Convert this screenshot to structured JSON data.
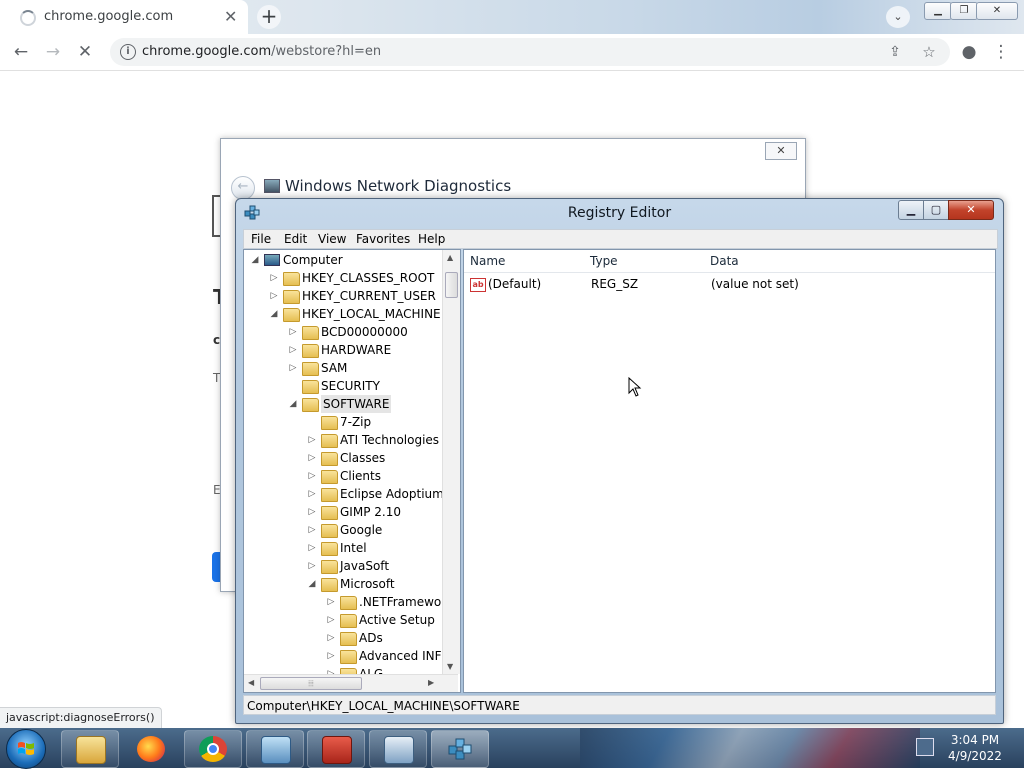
{
  "browser": {
    "tab_title": "chrome.google.com",
    "url_host": "chrome.google.com",
    "url_path": "/webstore?hl=en",
    "status_text": "javascript:diagnoseErrors()"
  },
  "net_diagnostics": {
    "title": "Windows Network Diagnostics"
  },
  "regedit": {
    "title": "Registry Editor",
    "menu": [
      "File",
      "Edit",
      "View",
      "Favorites",
      "Help"
    ],
    "tree": [
      {
        "label": "Computer",
        "level": 0,
        "arrow": "open"
      },
      {
        "label": "HKEY_CLASSES_ROOT",
        "level": 1,
        "arrow": "closed"
      },
      {
        "label": "HKEY_CURRENT_USER",
        "level": 1,
        "arrow": "closed"
      },
      {
        "label": "HKEY_LOCAL_MACHINE",
        "level": 1,
        "arrow": "open"
      },
      {
        "label": "BCD00000000",
        "level": 2,
        "arrow": "closed"
      },
      {
        "label": "HARDWARE",
        "level": 2,
        "arrow": "closed"
      },
      {
        "label": "SAM",
        "level": 2,
        "arrow": "closed"
      },
      {
        "label": "SECURITY",
        "level": 2,
        "arrow": "none"
      },
      {
        "label": "SOFTWARE",
        "level": 2,
        "arrow": "open",
        "selected": true
      },
      {
        "label": "7-Zip",
        "level": 3,
        "arrow": "none"
      },
      {
        "label": "ATI Technologies",
        "level": 3,
        "arrow": "closed"
      },
      {
        "label": "Classes",
        "level": 3,
        "arrow": "closed"
      },
      {
        "label": "Clients",
        "level": 3,
        "arrow": "closed"
      },
      {
        "label": "Eclipse Adoptium",
        "level": 3,
        "arrow": "closed"
      },
      {
        "label": "GIMP 2.10",
        "level": 3,
        "arrow": "closed"
      },
      {
        "label": "Google",
        "level": 3,
        "arrow": "closed"
      },
      {
        "label": "Intel",
        "level": 3,
        "arrow": "closed"
      },
      {
        "label": "JavaSoft",
        "level": 3,
        "arrow": "closed"
      },
      {
        "label": "Microsoft",
        "level": 3,
        "arrow": "open"
      },
      {
        "label": ".NETFramewor",
        "level": 4,
        "arrow": "closed"
      },
      {
        "label": "Active Setup",
        "level": 4,
        "arrow": "closed"
      },
      {
        "label": "ADs",
        "level": 4,
        "arrow": "closed"
      },
      {
        "label": "Advanced INF",
        "level": 4,
        "arrow": "closed"
      },
      {
        "label": "ALG",
        "level": 4,
        "arrow": "closed"
      }
    ],
    "columns": {
      "name": "Name",
      "type": "Type",
      "data": "Data"
    },
    "values": [
      {
        "name": "(Default)",
        "type": "REG_SZ",
        "data": "(value not set)"
      }
    ],
    "status_path": "Computer\\HKEY_LOCAL_MACHINE\\SOFTWARE"
  },
  "taskbar": {
    "apps": [
      "file-explorer",
      "firefox",
      "chrome",
      "control-panel",
      "toolbox",
      "network-diagnostics",
      "registry-editor"
    ],
    "time": "3:04 PM",
    "date": "4/9/2022"
  }
}
